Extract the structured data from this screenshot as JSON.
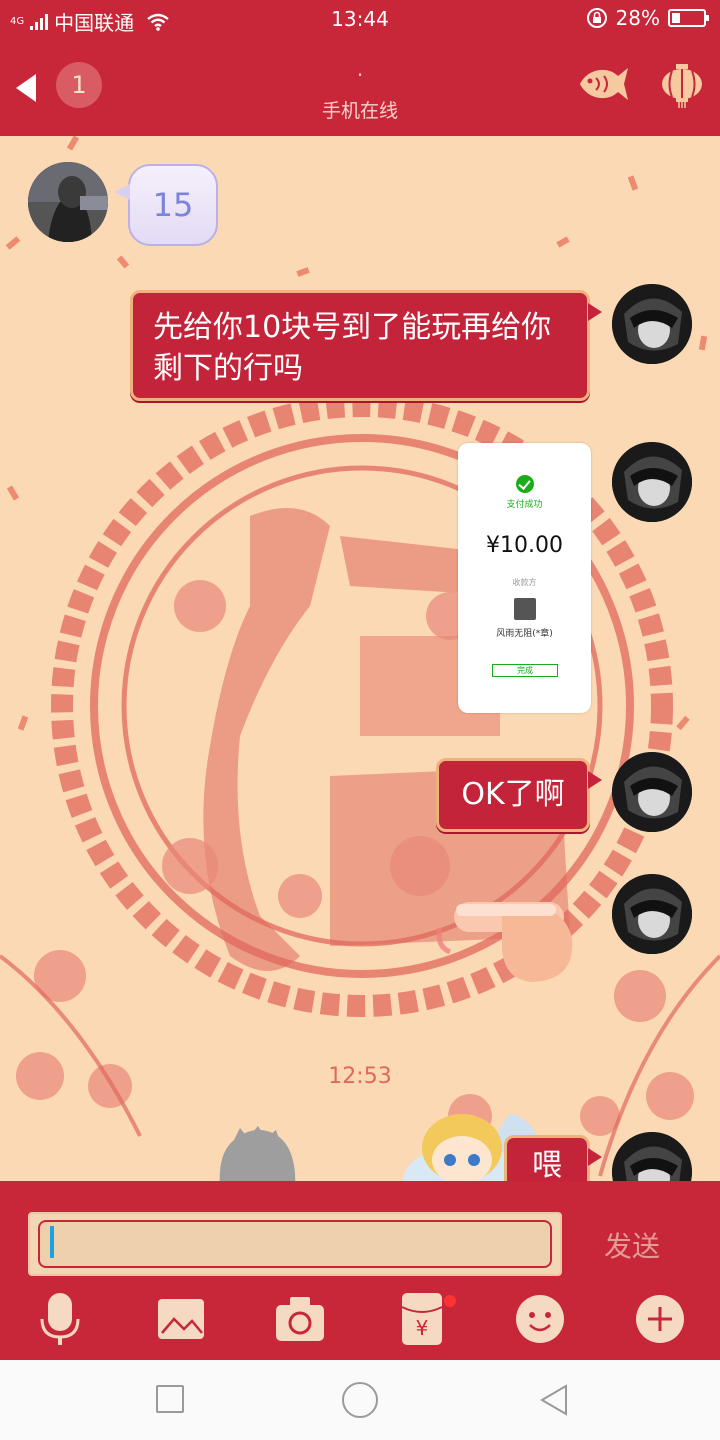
{
  "status_bar": {
    "network": "4G",
    "carrier": "中国联通",
    "time": "13:44",
    "battery": "28%",
    "battery_level": 0.28
  },
  "header": {
    "unread_count": "1",
    "dot": "·",
    "subtitle": "手机在线",
    "icons": [
      "back-arrow-icon",
      "fish-icon",
      "lantern-icon"
    ]
  },
  "messages": [
    {
      "side": "left",
      "text": "15"
    },
    {
      "side": "right",
      "text": "先给你10块号到了能玩再给你剩下的行吗"
    },
    {
      "side": "right",
      "type": "image",
      "payment": {
        "status": "支付成功",
        "amount": "¥10.00",
        "payee_label": "收款方",
        "payee_name": "风雨无阻(*章)",
        "button": "完成"
      }
    },
    {
      "side": "right",
      "text": "OK了啊"
    },
    {
      "side": "right",
      "type": "sticker",
      "sticker": "pointing-hand"
    },
    {
      "side": "right",
      "text": "喂"
    }
  ],
  "timestamp": "12:53",
  "input": {
    "placeholder": "",
    "send_label": "发送"
  },
  "toolbar": [
    "mic-icon",
    "image-icon",
    "camera-icon",
    "red-packet-icon",
    "emoji-icon",
    "plus-icon"
  ],
  "colors": {
    "theme_red": "#c8273a",
    "background": "#fbd9b4",
    "paper_cut": "#e0685c",
    "bubble_border": "#f0b27d",
    "send_text": "#e39c95"
  }
}
